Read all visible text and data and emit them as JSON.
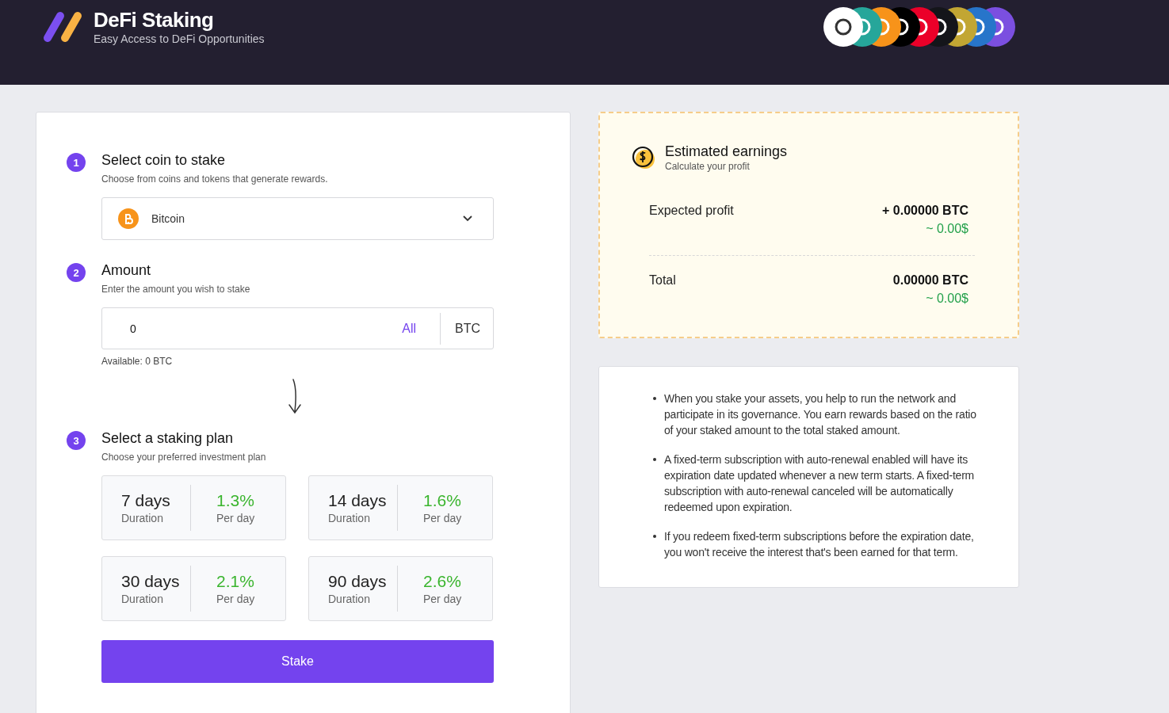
{
  "header": {
    "title": "DeFi Staking",
    "subtitle": "Easy Access to DeFi Opportunities",
    "coins": [
      {
        "color": "#ffffff"
      },
      {
        "color": "#26a69a"
      },
      {
        "color": "#f7931a"
      },
      {
        "color": "#000000"
      },
      {
        "color": "#eb0029"
      },
      {
        "color": "#14151a"
      },
      {
        "color": "#c2a633"
      },
      {
        "color": "#2775ca"
      },
      {
        "color": "#7b4fe0"
      }
    ]
  },
  "steps": [
    {
      "number": "1",
      "title": "Select coin to stake",
      "subtitle": "Choose from coins and tokens that generate rewards."
    },
    {
      "number": "2",
      "title": "Amount",
      "subtitle": "Enter the amount you wish to stake"
    },
    {
      "number": "3",
      "title": "Select a staking plan",
      "subtitle": "Choose your preferred investment plan"
    }
  ],
  "coin_select": {
    "value": "Bitcoin"
  },
  "amount": {
    "value": "0",
    "all_label": "All",
    "currency": "BTC",
    "available": "Available: 0 BTC"
  },
  "plans": [
    {
      "duration": "7 days",
      "duration_label": "Duration",
      "rate": "1.3%",
      "rate_label": "Per day"
    },
    {
      "duration": "14 days",
      "duration_label": "Duration",
      "rate": "1.6%",
      "rate_label": "Per day"
    },
    {
      "duration": "30 days",
      "duration_label": "Duration",
      "rate": "2.1%",
      "rate_label": "Per day"
    },
    {
      "duration": "90 days",
      "duration_label": "Duration",
      "rate": "2.6%",
      "rate_label": "Per day"
    }
  ],
  "stake_button": "Stake",
  "earnings": {
    "title": "Estimated earnings",
    "subtitle": "Calculate your profit",
    "rows": [
      {
        "label": "Expected profit",
        "crypto": "+ 0.00000 BTC",
        "fiat": "~ 0.00$"
      },
      {
        "label": "Total",
        "crypto": "0.00000 BTC",
        "fiat": "~ 0.00$"
      }
    ]
  },
  "notes": [
    "When you stake your assets, you help to run the network and participate in its governance. You earn rewards based on the ratio of your staked amount to the total staked amount.",
    "A fixed-term subscription with auto-renewal enabled will have its expiration date updated whenever a new term starts. A fixed-term subscription with auto-renewal canceled will be automatically redeemed upon expiration.",
    "If you redeem fixed-term subscriptions before the expiration date, you won't receive the interest that's been earned for that term."
  ]
}
